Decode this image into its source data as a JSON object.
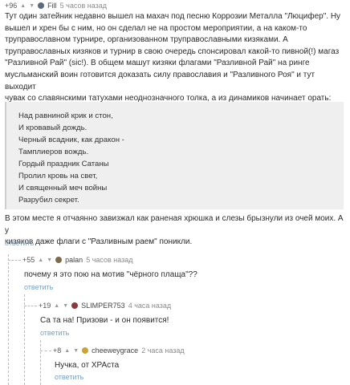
{
  "comment1": {
    "rating": "+96",
    "nick": "Fill",
    "time": "5 часов назад",
    "lines": [
      "Тут один затейник недавно вышел на махач под песню Коррозии Металла \"Люцифер\". Ну",
      "вышел и хрен бы с ним, но он сделал не на простом мероприятии, а на каком-то",
      "труправославном турнире, организованном труправославными кизяками. А",
      "труправославных кизяков и турнир в свою очередь спонсировал какой-то пивной(!) магаз",
      "\"Разливной Рай\" (sic!). В общем машут кизяки флагами \"Разливной Рай\" на ринге",
      "мусльманский воин готовится доказать силу православия и \"Разливного Роя\" и тут выходит",
      "чувак со славянскими татухами неоднозначного толка, а из динамиков начинает орать:"
    ],
    "quote": [
      "Над равниной крик и стон,",
      "И кровавый дождь.",
      "Черный всадник, как дракон -",
      "Тамплиеров вождь.",
      "Гордый праздник Сатаны",
      "Пролил кровь на свет,",
      "И священный меч войны",
      "Разрубил секрет."
    ],
    "after": [
      "В этом месте я отчаянно завизжал как раненая хрюшка и слезы брызнули из очей моих. А у",
      "кизяков даже флаги с \"Разливным раем\" поникли."
    ],
    "reply": "ответить"
  },
  "comment2": {
    "rating": "+55",
    "nick": "palan",
    "time": "5 часов назад",
    "text": "почему я это пою на мотив \"чёрного плаща\"??",
    "reply": "ответить"
  },
  "comment3": {
    "rating": "+19",
    "nick": "SLIMPER753",
    "time": "4 часа назад",
    "text": "Са та на! Призови - и он появится!",
    "reply": "ответить"
  },
  "comment4": {
    "rating": "+8",
    "nick": "cheeweygrace",
    "time": "2 часа назад",
    "text": "Нучка, от ХРАста",
    "reply": "ответить"
  },
  "colors": {
    "link": "#78a2c4",
    "quote_bg": "#efefef",
    "thread_line": "#bbbbbb"
  },
  "icons": {
    "vote_up": "chevron-up-icon",
    "vote_down": "chevron-down-icon"
  }
}
